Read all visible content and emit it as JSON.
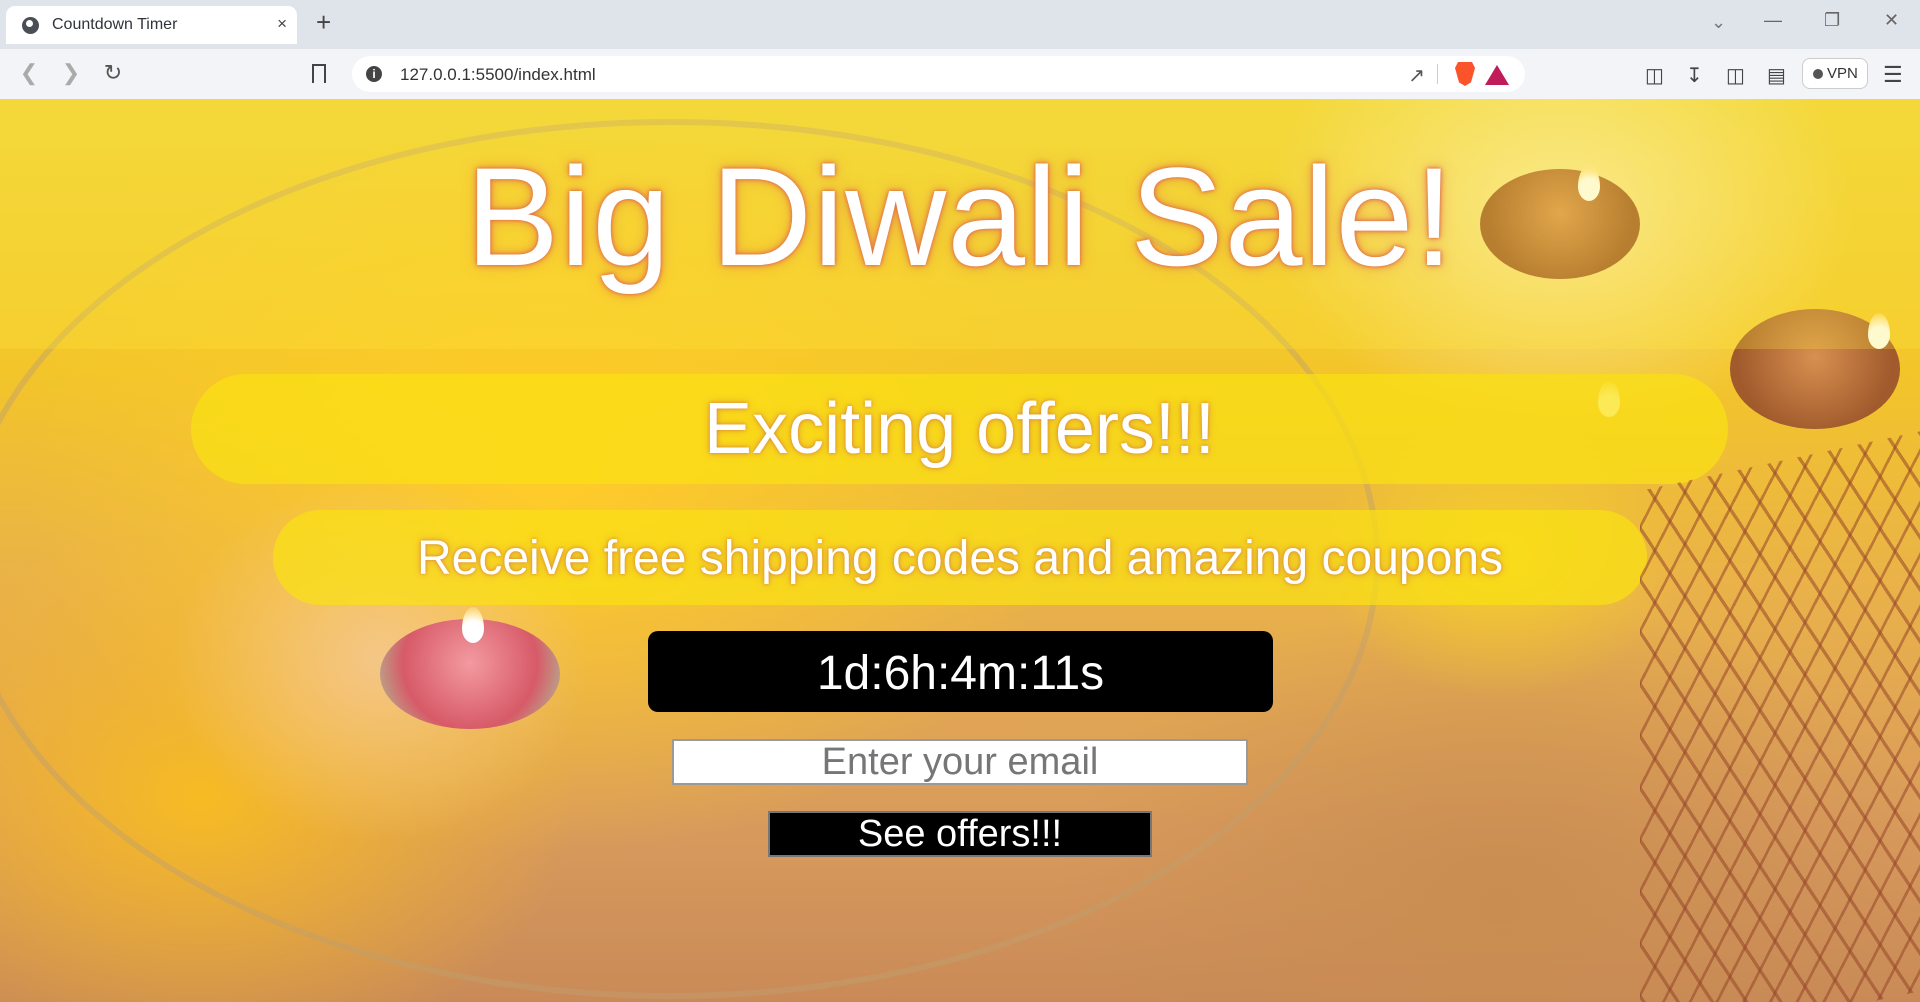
{
  "browser": {
    "tab_title": "Countdown Timer",
    "tab_close": "×",
    "new_tab": "+",
    "url": "127.0.0.1:5500/index.html",
    "vpn_label": "VPN"
  },
  "page": {
    "headline": "Big Diwali Sale!",
    "offer_heading": "Exciting offers!!!",
    "offer_subtext": "Receive free shipping codes and amazing coupons",
    "countdown": "1d:6h:4m:11s",
    "email_placeholder": "Enter your email",
    "submit_label": "See offers!!!"
  },
  "colors": {
    "accent_yellow": "#fae114",
    "text_glow": "#e2704a",
    "timer_bg": "#000000"
  }
}
